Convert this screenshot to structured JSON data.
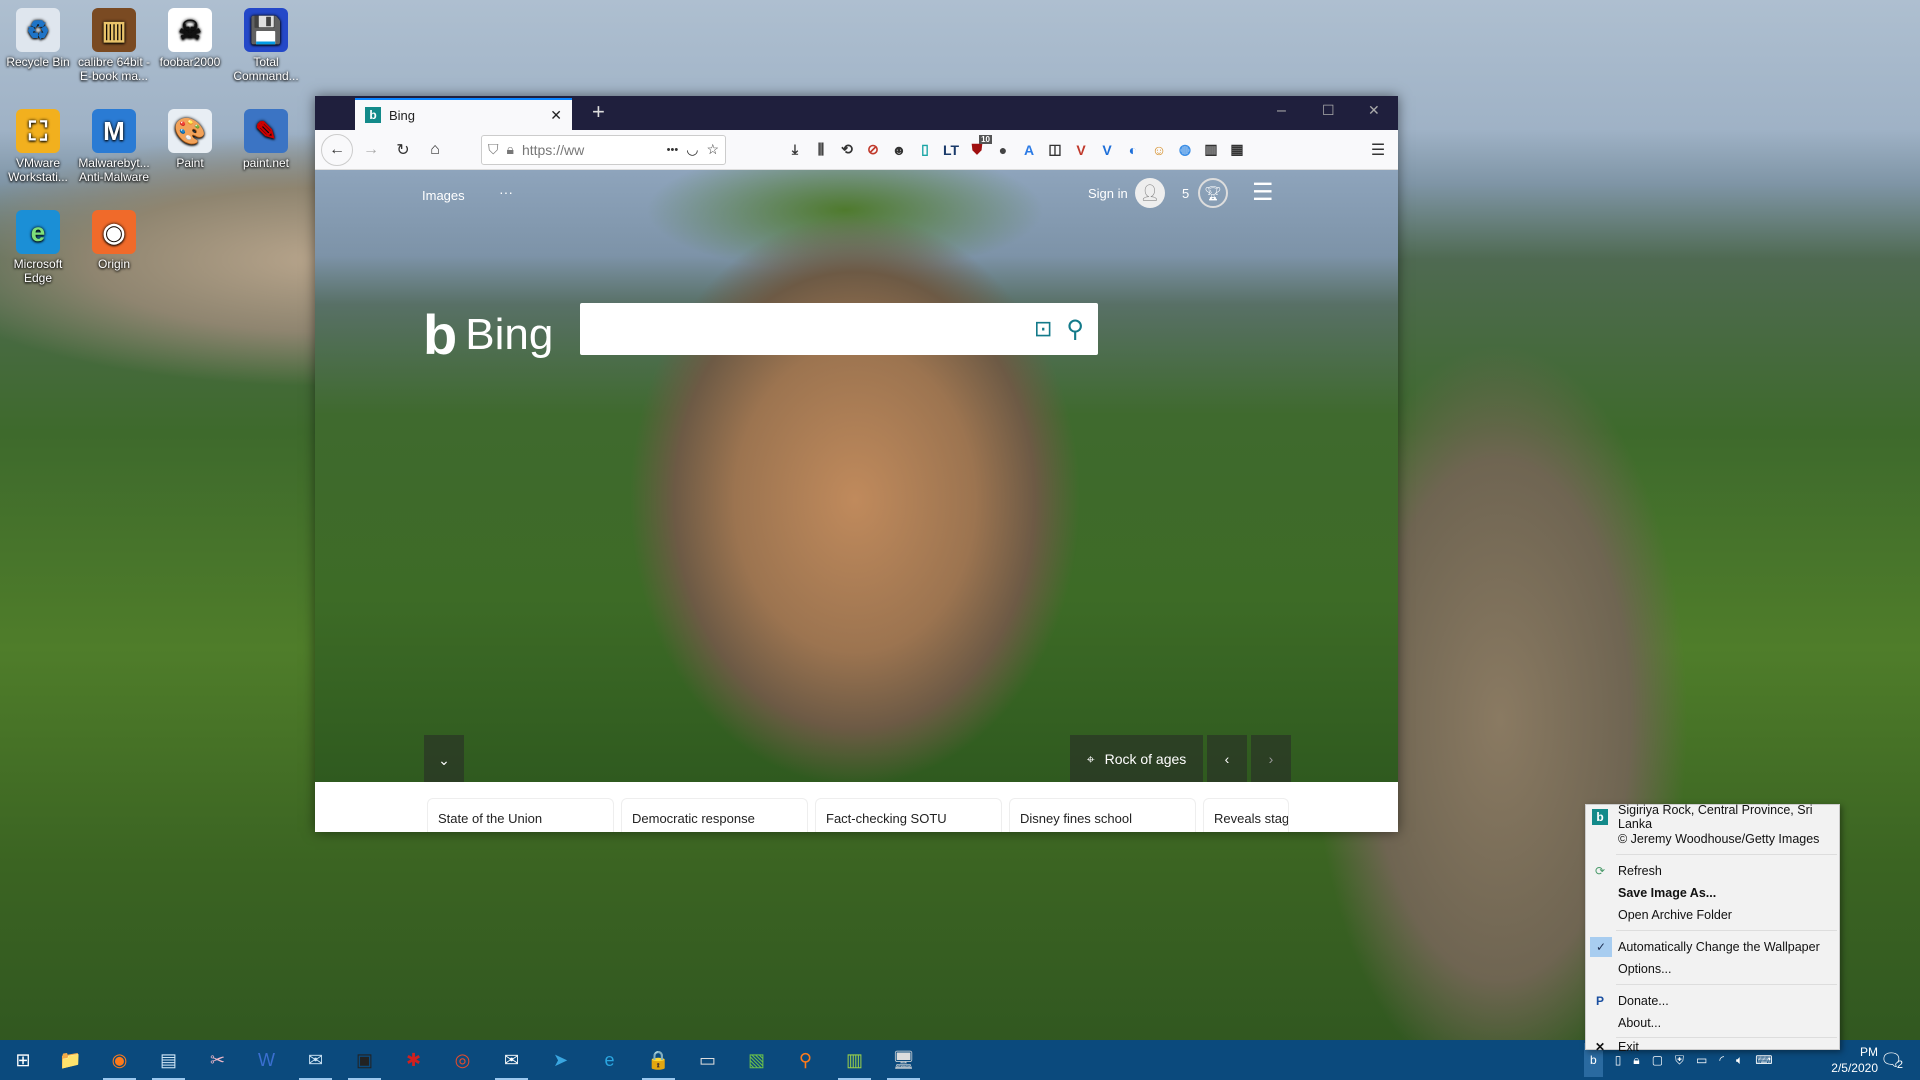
{
  "desktop": {
    "icons": [
      {
        "label": "Recycle Bin",
        "icon": "recycle-bin-icon",
        "glyph": "♻",
        "color": "#dfe6ee",
        "fg": "#1e74c8"
      },
      {
        "label": "calibre 64bit - E-book ma...",
        "icon": "calibre-icon",
        "glyph": "▥",
        "color": "#7a4a22",
        "fg": "#e9c36a"
      },
      {
        "label": "foobar2000",
        "icon": "foobar2000-icon",
        "glyph": "☠",
        "color": "#ffffff",
        "fg": "#111"
      },
      {
        "label": "Total Command...",
        "icon": "total-commander-icon",
        "glyph": "💾",
        "color": "#2448c8",
        "fg": "#fff"
      },
      {
        "label": "VMware Workstati...",
        "icon": "vmware-icon",
        "glyph": "⛶",
        "color": "#f2b01e",
        "fg": "#fff"
      },
      {
        "label": "Malwarebyt... Anti-Malware",
        "icon": "malwarebytes-icon",
        "glyph": "M",
        "color": "#2a7bd4",
        "fg": "#fff"
      },
      {
        "label": "Paint",
        "icon": "paint-icon",
        "glyph": "🎨",
        "color": "#e8eef4",
        "fg": "#333"
      },
      {
        "label": "paint.net",
        "icon": "paintnet-icon",
        "glyph": "✎",
        "color": "#3b74c4",
        "fg": "#c00"
      },
      {
        "label": "Microsoft Edge",
        "icon": "edge-icon",
        "glyph": "e",
        "color": "#1b8fd6",
        "fg": "#7ee07a"
      },
      {
        "label": "Origin",
        "icon": "origin-icon",
        "glyph": "◉",
        "color": "#f06a2a",
        "fg": "#fff"
      }
    ]
  },
  "browser": {
    "tab_title": "Bing",
    "tab_icon": "b",
    "new_tab": "+",
    "url": "https://ww",
    "page_actions": "•••",
    "extensions": [
      {
        "icon": "download-icon",
        "glyph": "⤓",
        "color": "#333"
      },
      {
        "icon": "library-icon",
        "glyph": "⫼",
        "color": "#333"
      },
      {
        "icon": "sync-icon",
        "glyph": "⟲",
        "color": "#333"
      },
      {
        "icon": "blocker-icon",
        "glyph": "⊘",
        "color": "#c0392b"
      },
      {
        "icon": "ghost-icon",
        "glyph": "☻",
        "color": "#333"
      },
      {
        "icon": "bookmark-icon",
        "glyph": "▯",
        "color": "#1aa5a5"
      },
      {
        "icon": "languagetool-icon",
        "glyph": "LT",
        "color": "#1a3a6a"
      },
      {
        "icon": "ublock-icon",
        "glyph": "⛊",
        "color": "#a01010",
        "badge": "10"
      },
      {
        "icon": "cookie-icon",
        "glyph": "●",
        "color": "#444"
      },
      {
        "icon": "translate-icon",
        "glyph": "A",
        "color": "#2c7be5"
      },
      {
        "icon": "sidebar-icon",
        "glyph": "◫",
        "color": "#333"
      },
      {
        "icon": "vivaldi-v-icon",
        "glyph": "V",
        "color": "#c0392b"
      },
      {
        "icon": "v-blue-icon",
        "glyph": "V",
        "color": "#1e6fd9"
      },
      {
        "icon": "circle-blue-icon",
        "glyph": "◐",
        "color": "#1e6fd9"
      },
      {
        "icon": "monkey-icon",
        "glyph": "☺",
        "color": "#d48a1e"
      },
      {
        "icon": "globe-icon",
        "glyph": "◍",
        "color": "#3b8ee6"
      },
      {
        "icon": "barcode-icon",
        "glyph": "▥",
        "color": "#333"
      },
      {
        "icon": "grid-plus-icon",
        "glyph": "▦",
        "color": "#333"
      }
    ],
    "window_controls": {
      "minimize": "–",
      "maximize": "☐",
      "close": "✕"
    }
  },
  "bing": {
    "nav_images": "Images",
    "nav_more": "···",
    "sign_in": "Sign in",
    "rewards_count": "5",
    "logo_text": "Bing",
    "search_placeholder": "",
    "location_label": "Rock of ages",
    "news": [
      "State of the Union",
      "Democratic response",
      "Fact-checking SOTU",
      "Disney fines school",
      "Reveals stage"
    ]
  },
  "context_menu": {
    "title": "Sigiriya Rock, Central Province, Sri Lanka",
    "copyright": "© Jeremy Woodhouse/Getty Images",
    "items": {
      "refresh": "Refresh",
      "save": "Save Image As...",
      "archive": "Open Archive Folder",
      "auto": "Automatically Change the Wallpaper",
      "options": "Options...",
      "donate": "Donate...",
      "about": "About...",
      "exit": "Exit"
    },
    "auto_checked": true
  },
  "taskbar": {
    "apps": [
      {
        "icon": "start-icon",
        "glyph": "⊞",
        "color": "#fff",
        "running": false
      },
      {
        "icon": "file-explorer-icon",
        "glyph": "📁",
        "color": "#f3c53c",
        "running": false
      },
      {
        "icon": "firefox-icon",
        "glyph": "◉",
        "color": "#ff7a1a",
        "running": true
      },
      {
        "icon": "notepad-icon",
        "glyph": "▤",
        "color": "#cfe6f7",
        "running": true
      },
      {
        "icon": "snip-icon",
        "glyph": "✂",
        "color": "#f0b8c8",
        "running": false
      },
      {
        "icon": "word-icon",
        "glyph": "W",
        "color": "#3a6fd0",
        "running": false
      },
      {
        "icon": "mail-client-icon",
        "glyph": "✉",
        "color": "#cfe6f7",
        "running": true
      },
      {
        "icon": "terminal-icon",
        "glyph": "▣",
        "color": "#222",
        "running": true
      },
      {
        "icon": "tool-red-icon",
        "glyph": "✱",
        "color": "#d02020",
        "running": false
      },
      {
        "icon": "chrome-icon",
        "glyph": "◎",
        "color": "#e84a2a",
        "running": false
      },
      {
        "icon": "mail-icon",
        "glyph": "✉",
        "color": "#fff",
        "running": true
      },
      {
        "icon": "telegram-icon",
        "glyph": "➤",
        "color": "#3aa6e0",
        "running": false
      },
      {
        "icon": "edge-icon",
        "glyph": "e",
        "color": "#2aa6e0",
        "running": false
      },
      {
        "icon": "vpn-icon",
        "glyph": "🔒",
        "color": "#fff",
        "running": true
      },
      {
        "icon": "monitor-icon",
        "glyph": "▭",
        "color": "#ddd",
        "running": false
      },
      {
        "icon": "rss-icon",
        "glyph": "▧",
        "color": "#6ac04a",
        "running": false
      },
      {
        "icon": "search-app-icon",
        "glyph": "⚲",
        "color": "#ff7a1a",
        "running": false
      },
      {
        "icon": "notepadpp-icon",
        "glyph": "▥",
        "color": "#9ad04a",
        "running": true
      },
      {
        "icon": "computer-icon",
        "glyph": "🖥",
        "color": "#ddd",
        "running": true
      }
    ],
    "clock_time": "PM",
    "clock_date": "2/5/2020",
    "notifications": "2"
  }
}
